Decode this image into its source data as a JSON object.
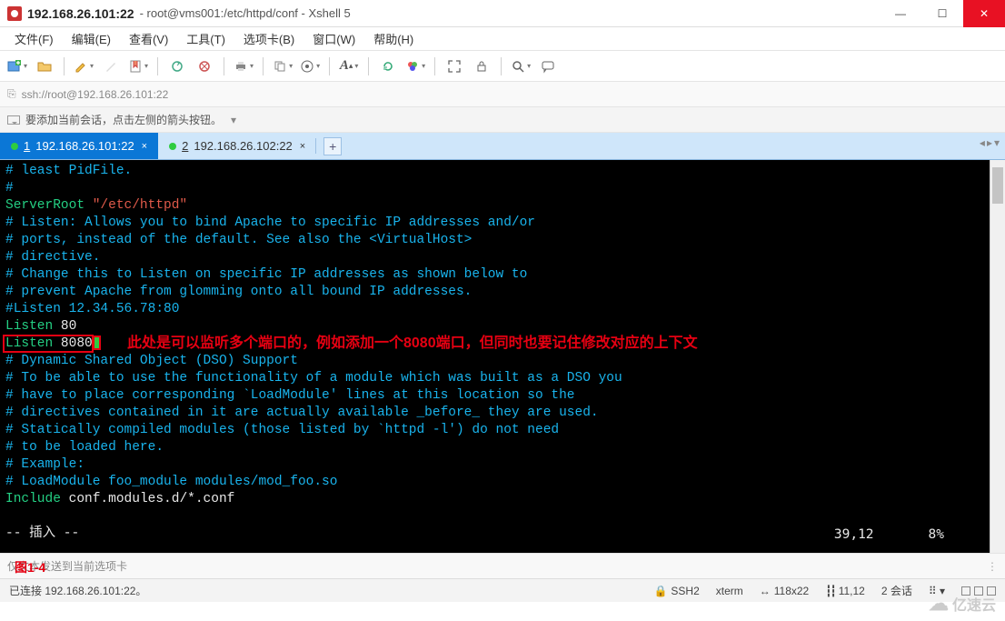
{
  "title": {
    "host": "192.168.26.101:22",
    "path": "root@vms001:/etc/httpd/conf - Xshell 5"
  },
  "menu": {
    "file": "文件(F)",
    "edit": "编辑(E)",
    "view": "查看(V)",
    "tools": "工具(T)",
    "tab": "选项卡(B)",
    "window": "窗口(W)",
    "help": "帮助(H)"
  },
  "address": {
    "url": "ssh://root@192.168.26.101:22"
  },
  "hint": {
    "text": "要添加当前会话，点击左侧的箭头按钮。"
  },
  "tabs": {
    "items": [
      {
        "num": "1",
        "label": "192.168.26.101:22"
      },
      {
        "num": "2",
        "label": "192.168.26.102:22"
      }
    ]
  },
  "terminal": {
    "lines": {
      "l1": "# least PidFile.",
      "l2": "#",
      "l3a": "ServerRoot",
      "l3b": "\"/etc/httpd\"",
      "l4": "# Listen: Allows you to bind Apache to specific IP addresses and/or",
      "l5": "# ports, instead of the default. See also the <VirtualHost>",
      "l6": "# directive.",
      "l7": "# Change this to Listen on specific IP addresses as shown below to",
      "l8": "# prevent Apache from glomming onto all bound IP addresses.",
      "l9": "#Listen 12.34.56.78:80",
      "l10a": "Listen",
      "l10b": "80",
      "l11a": "Listen",
      "l11b": "8080",
      "l12": "# Dynamic Shared Object (DSO) Support",
      "l13": "# To be able to use the functionality of a module which was built as a DSO you",
      "l14": "# have to place corresponding `LoadModule' lines at this location so the",
      "l15": "# directives contained in it are actually available _before_ they are used.",
      "l16": "# Statically compiled modules (those listed by `httpd -l') do not need",
      "l17": "# to be loaded here.",
      "l18": "# Example:",
      "l19": "# LoadModule foo_module modules/mod_foo.so",
      "l20a": "Include",
      "l20b": "conf.modules.d/*.conf",
      "mode": "-- 插入 --",
      "pos": "39,12",
      "pct": "8%"
    },
    "annotation": "此处是可以监听多个端口的，例如添加一个8080端口，但同时也要记住修改对应的上下文"
  },
  "linkbar": {
    "text": "仅文本发送到当前选项卡"
  },
  "figure": "图1-4",
  "status": {
    "conn": "已连接 192.168.26.101:22。",
    "proto": "SSH2",
    "term": "xterm",
    "size": "118x22",
    "cursor": "11,12",
    "sessions": "2 会话"
  },
  "brand": "亿速云"
}
